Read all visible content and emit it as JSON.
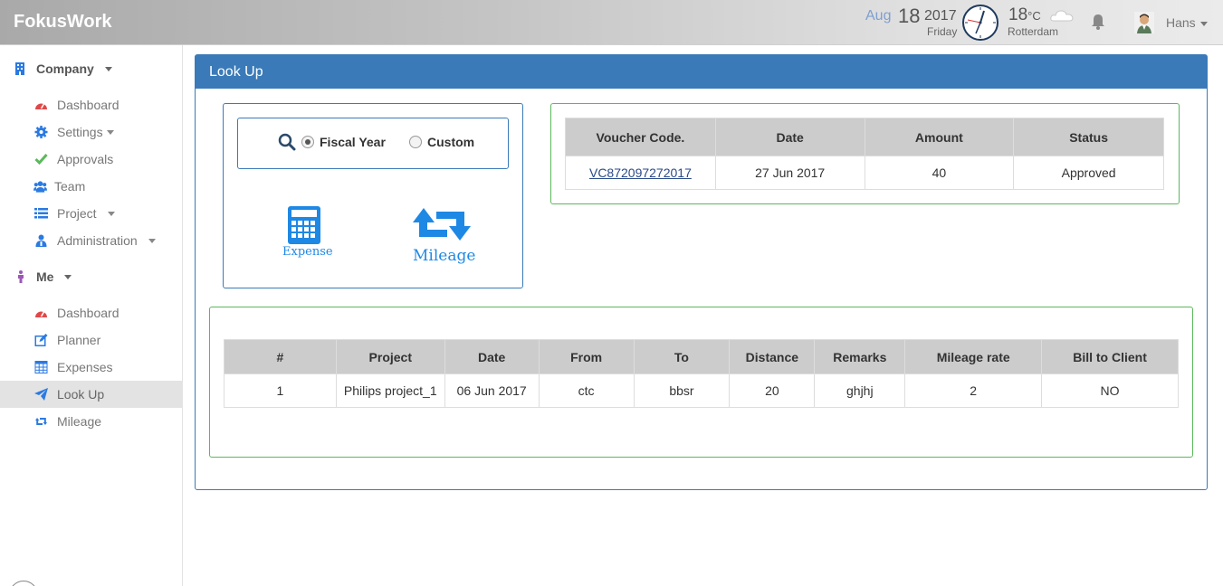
{
  "header": {
    "brand": "FokusWork",
    "date_month": "Aug",
    "date_day": "18",
    "date_year": "2017",
    "date_weekday": "Friday",
    "temperature": "18",
    "temperature_unit": "°C",
    "city": "Rotterdam",
    "user_name": "Hans"
  },
  "sidebar": {
    "company_label": "Company",
    "company_items": [
      {
        "label": "Dashboard",
        "icon": "dashboard-icon"
      },
      {
        "label": "Settings",
        "icon": "gear-icon"
      },
      {
        "label": "Approvals",
        "icon": "check-icon"
      },
      {
        "label": "Team",
        "icon": "users-icon"
      },
      {
        "label": "Project",
        "icon": "list-icon"
      },
      {
        "label": "Administration",
        "icon": "admin-icon"
      }
    ],
    "me_label": "Me",
    "me_items": [
      {
        "label": "Dashboard",
        "icon": "dashboard-icon"
      },
      {
        "label": "Planner",
        "icon": "edit-icon"
      },
      {
        "label": "Expenses",
        "icon": "table-icon"
      },
      {
        "label": "Look Up",
        "icon": "paper-plane-icon"
      },
      {
        "label": "Mileage",
        "icon": "retweet-icon"
      }
    ]
  },
  "panel": {
    "title": "Look Up",
    "filter": {
      "option_fiscal": "Fiscal Year",
      "option_custom": "Custom",
      "selected": "Fiscal Year"
    },
    "tiles": {
      "expense": "Expense",
      "mileage": "Mileage"
    }
  },
  "voucher_table": {
    "headers": [
      "Voucher Code.",
      "Date",
      "Amount",
      "Status"
    ],
    "rows": [
      [
        "VC872097272017",
        "27 Jun 2017",
        "40",
        "Approved"
      ]
    ]
  },
  "mileage_table": {
    "headers": [
      "#",
      "Project",
      "Date",
      "From",
      "To",
      "Distance",
      "Remarks",
      "Mileage rate",
      "Bill to Client"
    ],
    "rows": [
      [
        "1",
        "Philips project_1",
        "06 Jun 2017",
        "ctc",
        "bbsr",
        "20",
        "ghjhj",
        "2",
        "NO"
      ]
    ]
  },
  "colors": {
    "panel_blue": "#3a7ab8",
    "table_border_green": "#5cb85c",
    "tile_blue": "#1e88e5"
  }
}
